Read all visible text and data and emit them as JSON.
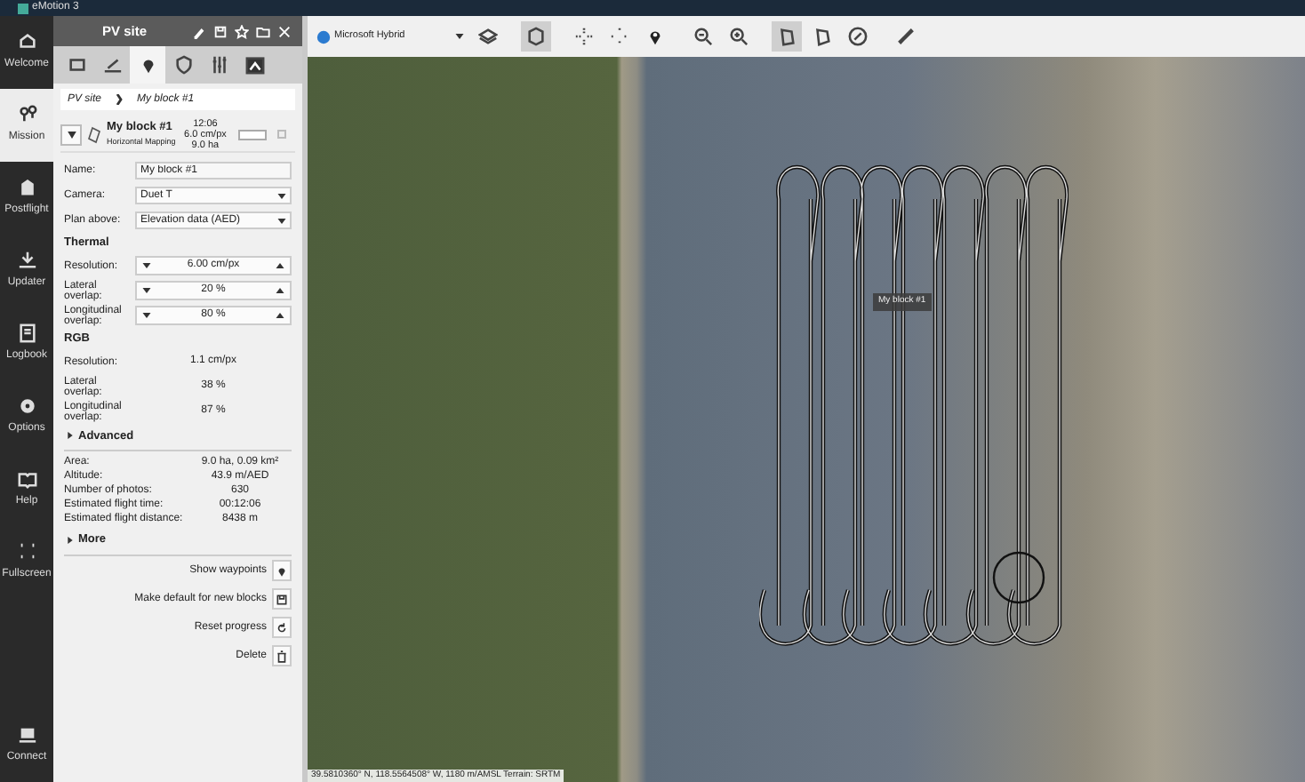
{
  "window": {
    "title": "eMotion 3"
  },
  "nav": [
    {
      "label": "Welcome",
      "selected": false
    },
    {
      "label": "Mission",
      "selected": true
    },
    {
      "label": "Postflight",
      "selected": false
    },
    {
      "label": "Updater",
      "selected": false
    },
    {
      "label": "Logbook",
      "selected": false
    },
    {
      "label": "Options",
      "selected": false
    },
    {
      "label": "Help",
      "selected": false
    },
    {
      "label": "Fullscreen",
      "selected": false
    }
  ],
  "nav_bottom": {
    "label": "Connect"
  },
  "panel": {
    "title": "PV site",
    "tabs": [
      {
        "selected": false
      },
      {
        "selected": false
      },
      {
        "selected": true
      },
      {
        "selected": false
      },
      {
        "selected": false
      },
      {
        "selected": false
      }
    ],
    "breadcrumb": [
      "PV site",
      "My block #1"
    ],
    "block": {
      "name": "My block #1",
      "subtitle": "Horizontal Mapping",
      "time": "12:06",
      "resolution": "6.0 cm/px",
      "area": "9.0 ha",
      "expanded": true,
      "checked": false,
      "level": 0
    },
    "fields": [
      {
        "kind": "input",
        "label": "Name:",
        "value": "My block #1"
      },
      {
        "kind": "select",
        "label": "Camera:",
        "value": "Duet T"
      },
      {
        "kind": "select",
        "label": "Plan above:",
        "value": "Elevation data (AED)"
      },
      {
        "kind": "heading",
        "label": "Thermal"
      },
      {
        "kind": "spinner",
        "label": "Resolution:",
        "value": "6.00 cm/px"
      },
      {
        "kind": "spinner",
        "label": "Lateral overlap:",
        "value": "20 %"
      },
      {
        "kind": "spinner",
        "label": "Longitudinal overlap:",
        "value": "80 %"
      },
      {
        "kind": "heading",
        "label": "RGB"
      },
      {
        "kind": "readout",
        "label": "Resolution:",
        "value": "1.1 cm/px"
      },
      {
        "kind": "readout",
        "label": "Lateral overlap:",
        "value": "38 %"
      },
      {
        "kind": "readout",
        "label": "Longitudinal overlap:",
        "value": "87 %"
      }
    ],
    "advanced": {
      "label": "Advanced",
      "expanded": false
    },
    "stats": [
      {
        "label": "Area:",
        "value": "9.0 ha, 0.09 km²"
      },
      {
        "label": "Altitude:",
        "value": "43.9 m/AED"
      },
      {
        "label": "Number of photos:",
        "value": "630"
      },
      {
        "label": "Estimated flight time:",
        "value": "00:12:06"
      },
      {
        "label": "Estimated flight distance:",
        "value": "8438 m"
      }
    ],
    "more": {
      "label": "More",
      "expanded": false
    },
    "actions": [
      {
        "label": "Show waypoints"
      },
      {
        "label": "Make default for new blocks"
      },
      {
        "label": "Reset progress"
      },
      {
        "label": "Delete"
      }
    ]
  },
  "map": {
    "layer": "Microsoft Hybrid",
    "toolbar": [
      {
        "selected": false
      },
      {
        "selected": true
      },
      {
        "selected": false
      },
      {
        "selected": false
      },
      {
        "selected": false
      },
      {
        "selected": false
      },
      {
        "selected": false
      },
      {
        "selected": true
      },
      {
        "selected": false
      },
      {
        "selected": false
      },
      {
        "selected": false
      }
    ],
    "block_label": "My block #1",
    "status": "39.5810360° N, 118.5564508° W, 1180 m/AMSL  Terrain: SRTM"
  }
}
